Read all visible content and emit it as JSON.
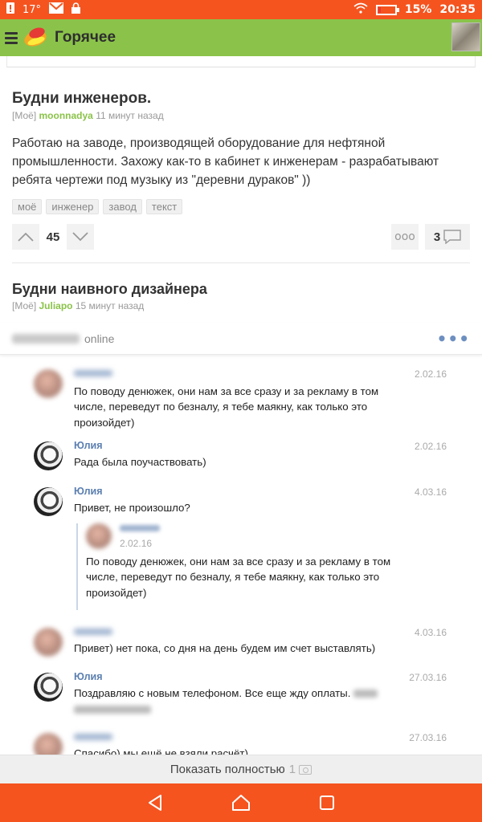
{
  "status_bar": {
    "temperature": "17°",
    "battery_percent": "15%",
    "battery_level": 0.15,
    "time": "20:35"
  },
  "app_bar": {
    "title": "Горячее"
  },
  "posts": [
    {
      "title": "Будни инженеров.",
      "community": "[Моё]",
      "author": "moonnadya",
      "time": "11 минут назад",
      "text": "Работаю на заводе, производящей оборудование для нефтяной промышленности. Захожу как-то в кабинет к инженерам - разрабатывают ребята чертежи под музыку из \"деревни дураков\" ))",
      "tags": [
        "моё",
        "инженер",
        "завод",
        "текст"
      ],
      "score": "45",
      "more": "ooo",
      "comments": "3"
    },
    {
      "title": "Будни наивного дизайнера",
      "community": "[Моё]",
      "author": "Juliapo",
      "time": "15 минут назад"
    }
  ],
  "chat": {
    "status": "online",
    "menu": "•••",
    "messages": [
      {
        "name": "",
        "date": "2.02.16",
        "text": "По поводу денюжек, они нам за все сразу и за рекламу в том числе, переведут по безналу, я тебе маякну, как только это произойдет)"
      },
      {
        "name": "Юлия",
        "date": "2.02.16",
        "text": "Рада была поучаствовать)"
      },
      {
        "name": "Юлия",
        "date": "4.03.16",
        "text": "Привет, не произошло?"
      },
      {
        "name": "",
        "date": "4.03.16",
        "text": "Привет) нет пока, со дня на день будем им счет выставлять)"
      },
      {
        "name": "Юлия",
        "date": "27.03.16",
        "text": "Поздравляю с новым телефоном. Все еще жду оплаты."
      },
      {
        "name": "",
        "date": "27.03.16",
        "text": "Спасибо) мы ещё не взяли расчёт)"
      }
    ],
    "quote": {
      "date": "2.02.16",
      "text": "По поводу денюжек, они нам за все сразу и за рекламу в том числе, переведут по безналу, я тебе маякну, как только это произойдет)"
    }
  },
  "show_full": {
    "label": "Показать полностью",
    "count": "1"
  },
  "colors": {
    "accent": "#f5541f",
    "appbar": "#8bc34a",
    "author": "#8bc34a",
    "chat_name": "#5b7fb0"
  }
}
